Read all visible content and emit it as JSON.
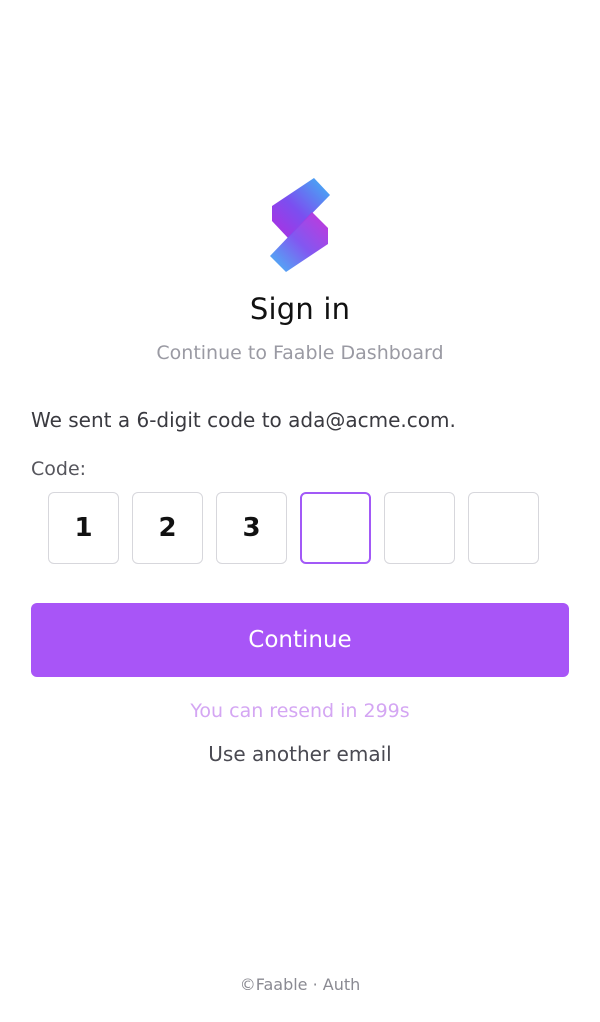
{
  "brand": {
    "logo_icon": "faable-logo-icon",
    "colors": {
      "accent": "#a855f7",
      "accent_light": "#d4a6f3",
      "gradient_blue": "#3db8f5",
      "gradient_purple": "#b12de0"
    }
  },
  "header": {
    "title": "Sign in",
    "subtitle": "Continue to Faable Dashboard"
  },
  "form": {
    "sent_message": "We sent a 6-digit code to ada@acme.com.",
    "code_label": "Code:",
    "digits": [
      "1",
      "2",
      "3",
      "",
      "",
      ""
    ],
    "active_index": 3,
    "continue_label": "Continue",
    "resend_text": "You can resend in 299s",
    "another_email_label": "Use another email"
  },
  "footer": {
    "text": "©Faable · Auth"
  }
}
